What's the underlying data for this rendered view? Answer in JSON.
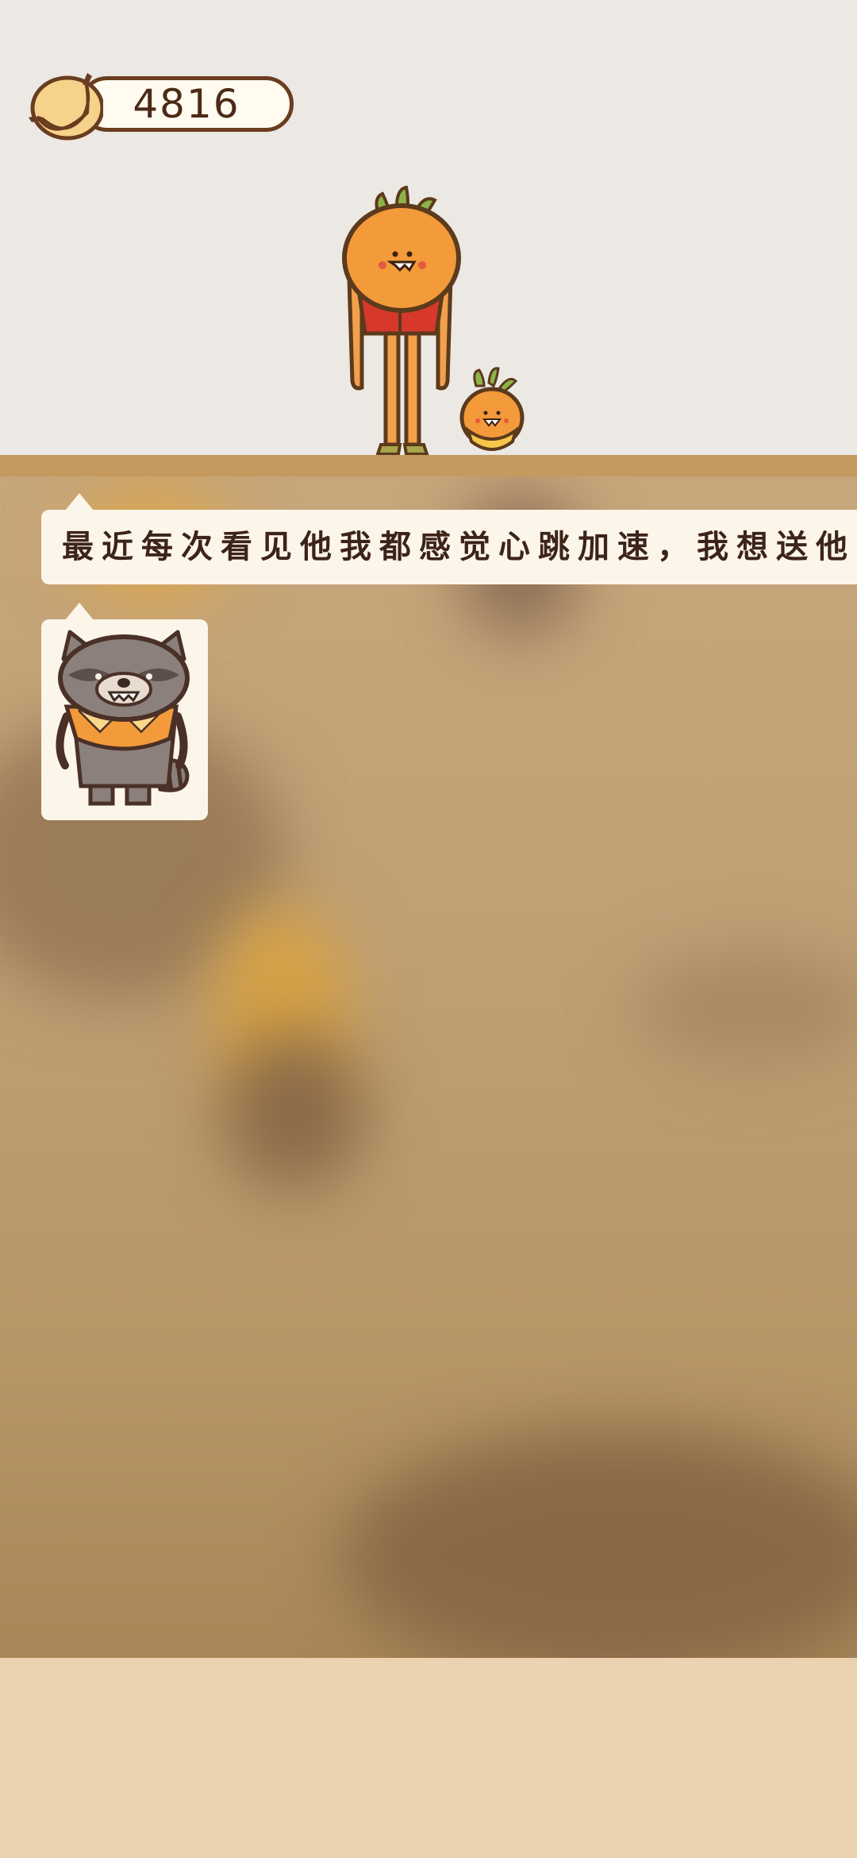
{
  "hud": {
    "currency_icon": "banana-icon",
    "currency_value": "4816"
  },
  "scene": {
    "characters": [
      "carrot-tall-icon",
      "carrot-small-icon"
    ]
  },
  "dialog": {
    "text": "最近每次看见他我都感觉心跳加速，我想送他",
    "speaker_icon": "raccoon-icon"
  },
  "colors": {
    "background_top": "#ece8e4",
    "floor": "#c49a5e",
    "game_area": "#c2a277",
    "bubble": "#fcf6ea",
    "bottom_panel": "#ebd3b1",
    "outline": "#6a3c20"
  }
}
